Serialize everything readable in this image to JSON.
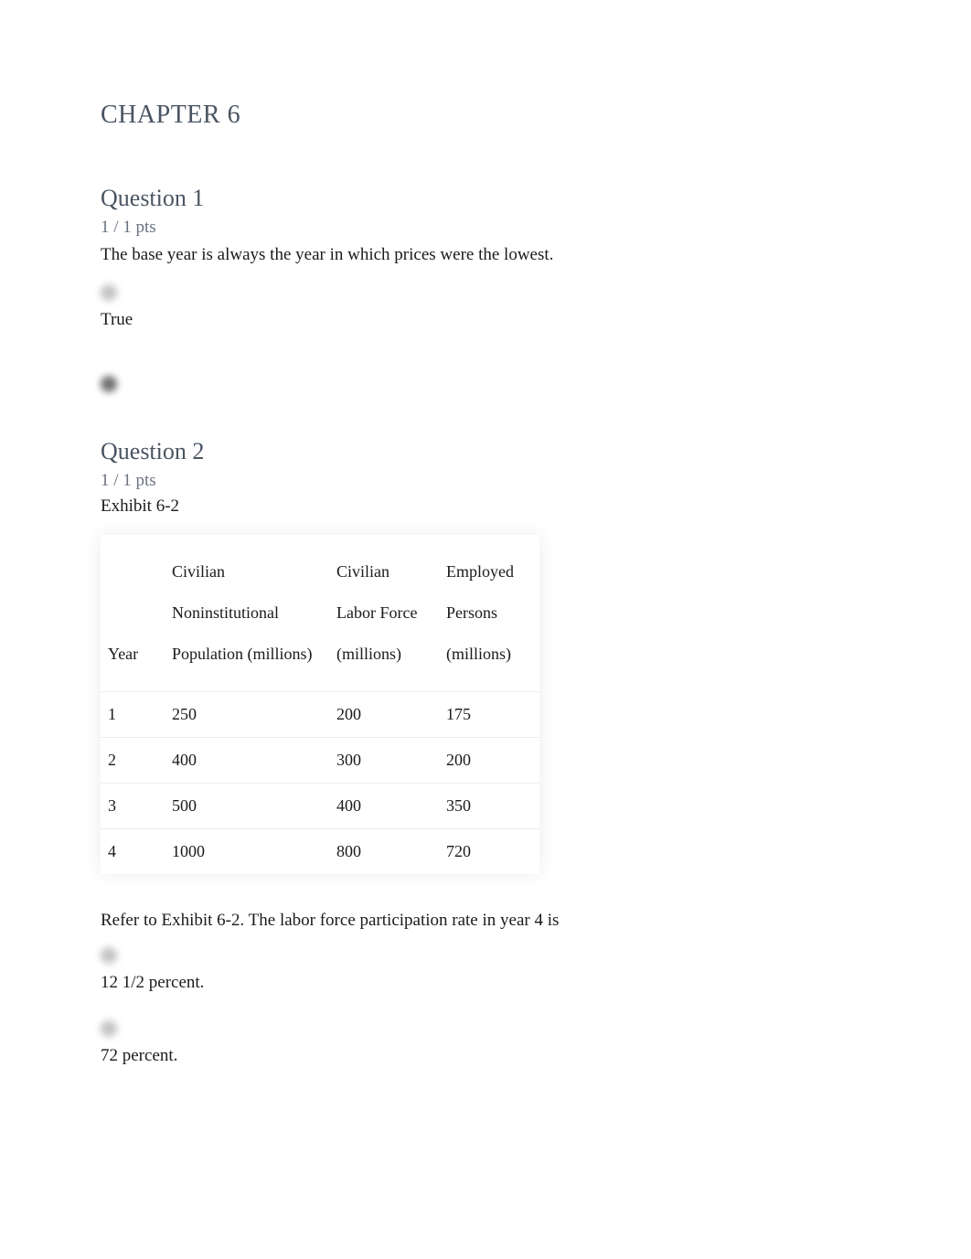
{
  "chapter": {
    "title": "CHAPTER 6"
  },
  "questions": [
    {
      "title": "Question 1",
      "points": "1 / 1 pts",
      "text": "The base year is always the year in which prices were the lowest.",
      "options": [
        {
          "label": "True"
        }
      ]
    },
    {
      "title": "Question 2",
      "points": "1 / 1 pts",
      "exhibit_label": "Exhibit 6-2",
      "table": {
        "headers": {
          "year": "Year",
          "pop_line1": "Civilian",
          "pop_line2": "Noninstitutional",
          "pop_line3": "Population (millions)",
          "labor_line1": "Civilian",
          "labor_line2": "Labor Force",
          "labor_line3": "(millions)",
          "emp_line1": "Employed",
          "emp_line2": "Persons",
          "emp_line3": "(millions)"
        },
        "rows": [
          {
            "year": "1",
            "pop": "250",
            "labor": "200",
            "emp": "175"
          },
          {
            "year": "2",
            "pop": "400",
            "labor": "300",
            "emp": "200"
          },
          {
            "year": "3",
            "pop": "500",
            "labor": "400",
            "emp": "350"
          },
          {
            "year": "4",
            "pop": "1000",
            "labor": "800",
            "emp": "720"
          }
        ]
      },
      "followup": "Refer to Exhibit 6-2. The labor force participation rate in year 4 is",
      "options": [
        {
          "label": "12 1/2 percent."
        },
        {
          "label": "72 percent."
        }
      ]
    }
  ]
}
